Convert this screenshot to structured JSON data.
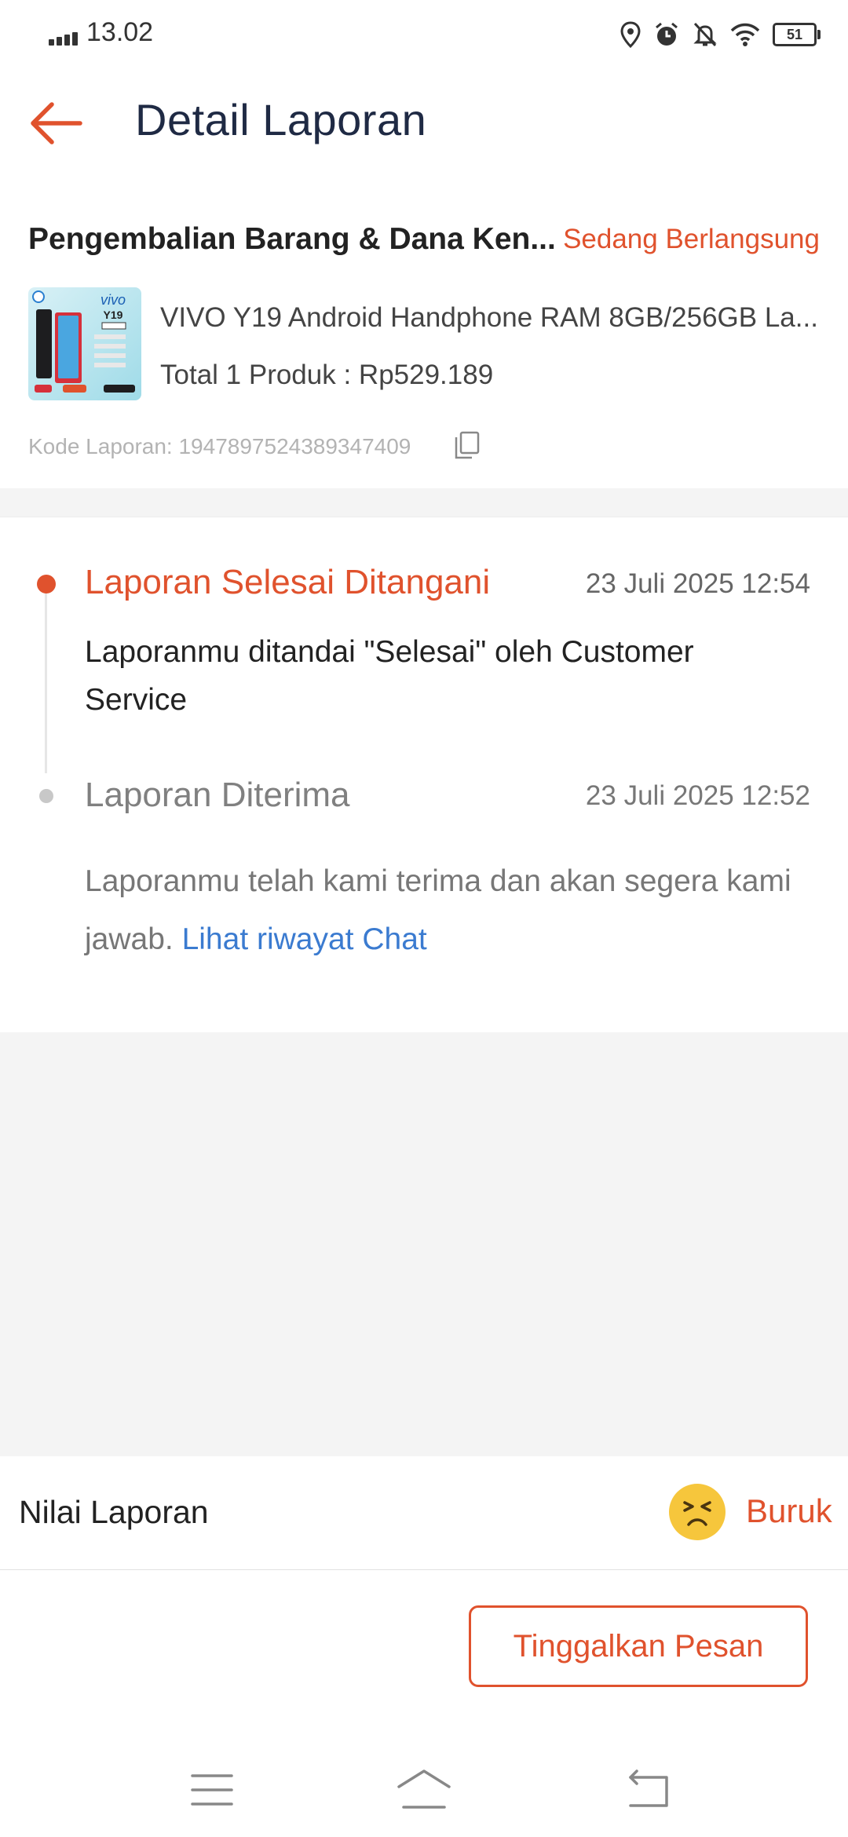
{
  "status_bar": {
    "time": "13.02",
    "battery": "51",
    "icons": [
      "signal-icon",
      "location-icon",
      "alarm-icon",
      "notifications-off-icon",
      "wifi-icon",
      "battery-icon"
    ]
  },
  "header": {
    "title": "Detail Laporan",
    "back_icon": "arrow-left-icon"
  },
  "report": {
    "title": "Pengembalian Barang & Dana Ken...",
    "status": "Sedang Berlangsung",
    "product_name": "VIVO Y19 Android Handphone RAM 8GB/256GB La...",
    "product_total": "Total 1 Produk : Rp529.189",
    "thumb_brand": "vivo",
    "thumb_model": "Y19",
    "code": "Kode Laporan: 1947897524389347409"
  },
  "timeline": [
    {
      "title": "Laporan Selesai Ditangani",
      "time": "23 Juli 2025 12:54",
      "desc": "Laporanmu ditandai \"Selesai\" oleh Customer Service"
    },
    {
      "title": "Laporan Diterima",
      "time": "23 Juli 2025 12:52",
      "desc": "Laporanmu telah kami terima dan akan segera kami jawab.",
      "link": "Lihat riwayat Chat"
    }
  ],
  "rating": {
    "label": "Nilai Laporan",
    "value": "Buruk",
    "emoji": "frowning-face-icon"
  },
  "actions": {
    "leave_message": "Tinggalkan Pesan"
  },
  "colors": {
    "accent": "#e0522d",
    "link": "#3b7bd0",
    "title": "#1f2a44",
    "background_gray": "#f4f4f4"
  }
}
